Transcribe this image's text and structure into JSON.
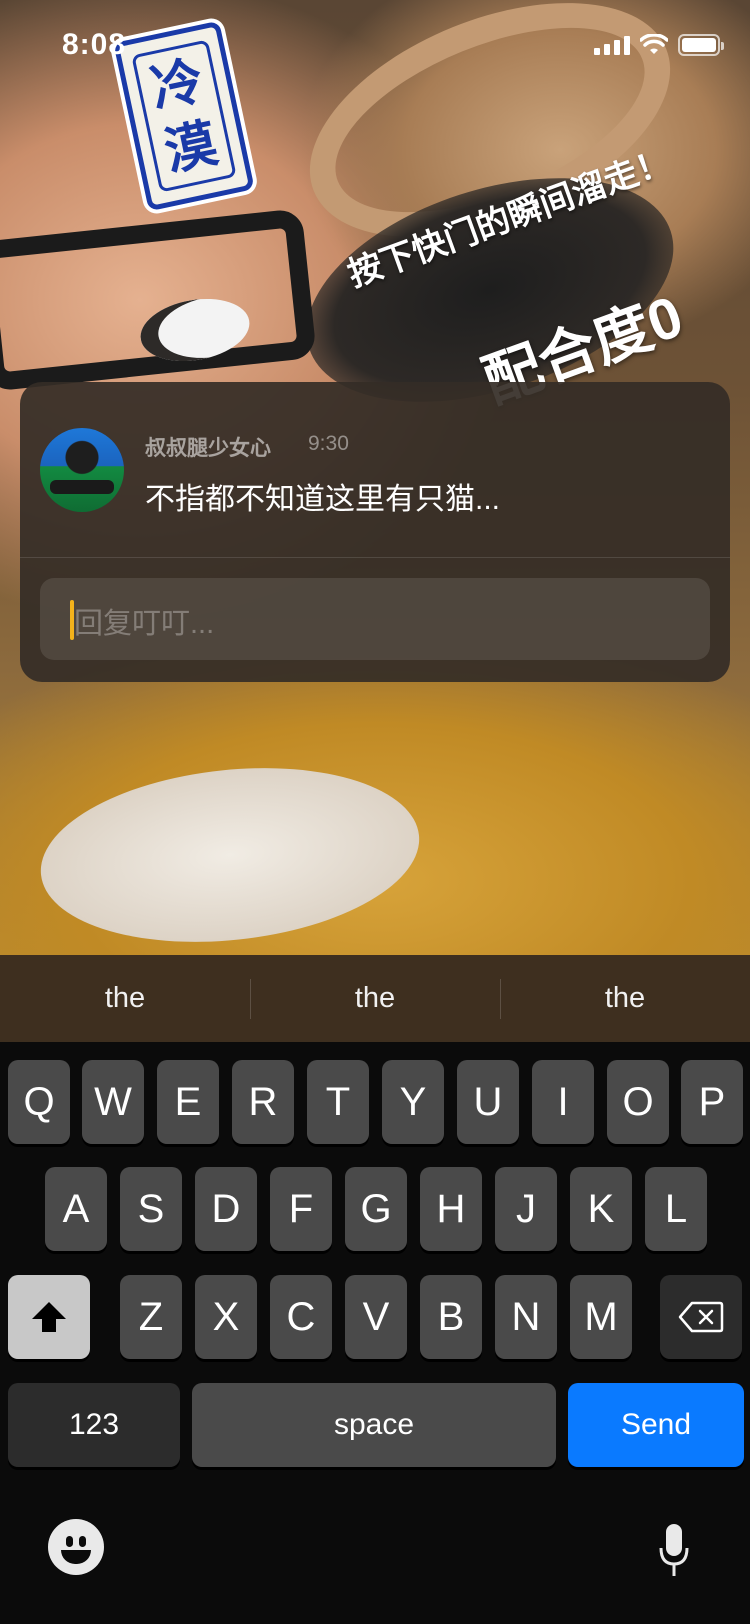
{
  "status_bar": {
    "time": "8:08"
  },
  "photo": {
    "sticker_text": "冷漠",
    "caption_line1": "按下快门的瞬间溜走！",
    "caption_line2": "配合度0"
  },
  "comment": {
    "username": "叔叔腿少女心",
    "time": "9:30",
    "text": "不指都不知道这里有只猫..."
  },
  "reply_input": {
    "placeholder": "回复叮叮..."
  },
  "keyboard": {
    "suggestions": [
      "the",
      "the",
      "the"
    ],
    "row1": [
      "Q",
      "W",
      "E",
      "R",
      "T",
      "Y",
      "U",
      "I",
      "O",
      "P"
    ],
    "row2": [
      "A",
      "S",
      "D",
      "F",
      "G",
      "H",
      "J",
      "K",
      "L"
    ],
    "row3": [
      "Z",
      "X",
      "C",
      "V",
      "B",
      "N",
      "M"
    ],
    "numbers_label": "123",
    "space_label": "space",
    "send_label": "Send",
    "send_color": "#0a7aff"
  }
}
